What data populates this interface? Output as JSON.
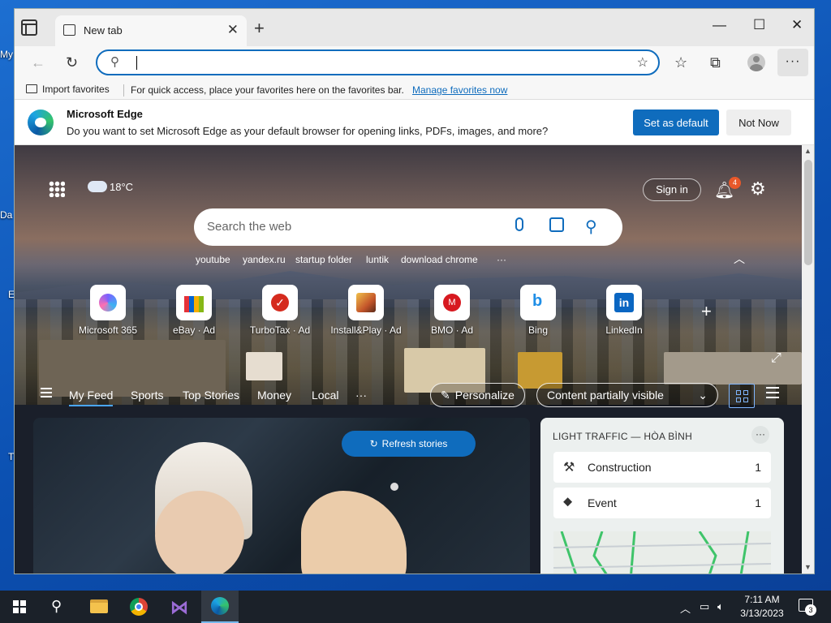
{
  "desktop": {
    "labels": [
      "My",
      "Da",
      "E",
      "T"
    ]
  },
  "browser": {
    "tab_title": "New tab",
    "address_value": "",
    "window_controls": {
      "minimize": "—",
      "maximize": "☐",
      "close": "✕"
    },
    "favorites_bar": {
      "import_label": "Import favorites",
      "message": "For quick access, place your favorites here on the favorites bar.",
      "link": "Manage favorites now"
    },
    "infobar": {
      "title": "Microsoft Edge",
      "message": "Do you want to set Microsoft Edge as your default browser for opening links, PDFs, images, and more?",
      "primary_button": "Set as default",
      "secondary_button": "Not Now"
    }
  },
  "newtab": {
    "weather": "18°C",
    "sign_in": "Sign in",
    "notifications_count": "4",
    "search_placeholder": "Search the web",
    "quick_links": [
      "youtube",
      "yandex.ru",
      "startup folder",
      "luntik",
      "download chrome"
    ],
    "tiles": [
      {
        "label": "Microsoft 365",
        "icon": "microsoft-365-icon",
        "color": "#7b61ff"
      },
      {
        "label": "eBay · Ad",
        "icon": "ebay-bag-icon",
        "color": "#e53238"
      },
      {
        "label": "TurboTax · Ad",
        "icon": "turbotax-check-icon",
        "color": "#d52b1e"
      },
      {
        "label": "Install&Play · Ad",
        "icon": "game-icon",
        "color": "#c4552a"
      },
      {
        "label": "BMO · Ad",
        "icon": "bmo-icon",
        "color": "#d71920"
      },
      {
        "label": "Bing",
        "icon": "bing-icon",
        "color": "#1f8ee6"
      },
      {
        "label": "LinkedIn",
        "icon": "linkedin-icon",
        "color": "#0a66c2"
      }
    ],
    "feed_nav": {
      "items": [
        "My Feed",
        "Sports",
        "Top Stories",
        "Money",
        "Local"
      ],
      "more": "···",
      "personalize": "Personalize",
      "content_visibility": "Content partially visible"
    },
    "refresh_button": "Refresh stories",
    "traffic": {
      "title": "LIGHT TRAFFIC — HÒA BÌNH",
      "rows": [
        {
          "label": "Construction",
          "count": "1"
        },
        {
          "label": "Event",
          "count": "1"
        }
      ]
    }
  },
  "taskbar": {
    "time": "7:11 AM",
    "date": "3/13/2023",
    "notifications": "3",
    "apps": [
      "file-explorer-icon",
      "chrome-icon",
      "visual-studio-icon",
      "edge-icon"
    ]
  },
  "colors": {
    "accent": "#0f6cbd",
    "taskbar": "#1b2129",
    "desktop": "#0b4fb0"
  }
}
